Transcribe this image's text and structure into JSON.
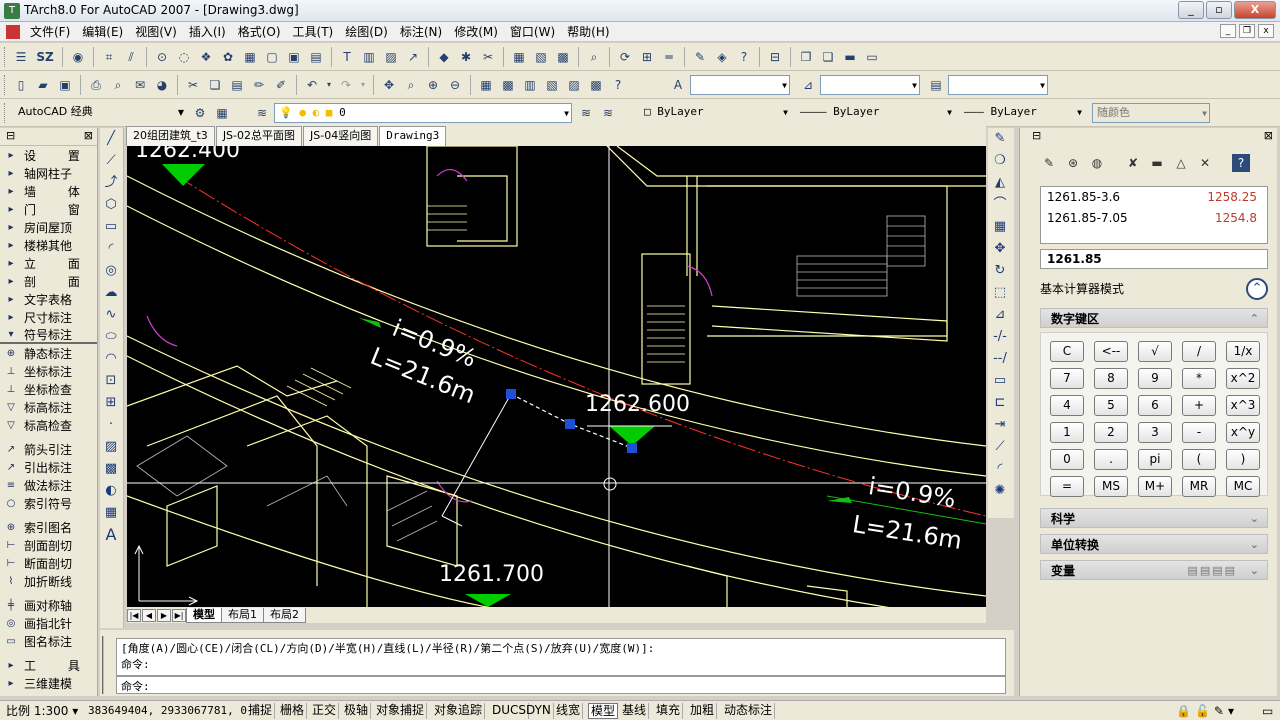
{
  "window": {
    "title": "TArch8.0 For AutoCAD 2007 - [Drawing3.dwg]",
    "min": "_",
    "max": "▫",
    "close": "X"
  },
  "menu": [
    "文件(F)",
    "编辑(E)",
    "视图(V)",
    "插入(I)",
    "格式(O)",
    "工具(T)",
    "绘图(D)",
    "标注(N)",
    "修改(M)",
    "窗口(W)",
    "帮助(H)"
  ],
  "toolbar1": {
    "sz_label": "SZ"
  },
  "toolbar3": {
    "workspace": "AutoCAD 经典",
    "layer": "0",
    "color": "ByLayer",
    "linetype": "ByLayer",
    "lineweight": "ByLayer",
    "plotstyle": "随颜色"
  },
  "left_panel": {
    "items": [
      {
        "icon": "▸",
        "label": "设  置",
        "sp": true
      },
      {
        "icon": "▸",
        "label": "轴网柱子"
      },
      {
        "icon": "▸",
        "label": "墙  体",
        "sp": true
      },
      {
        "icon": "▸",
        "label": "门  窗",
        "sp": true
      },
      {
        "icon": "▸",
        "label": "房间屋顶"
      },
      {
        "icon": "▸",
        "label": "楼梯其他"
      },
      {
        "icon": "▸",
        "label": "立  面",
        "sp": true
      },
      {
        "icon": "▸",
        "label": "剖  面",
        "sp": true
      },
      {
        "icon": "▸",
        "label": "文字表格"
      },
      {
        "icon": "▸",
        "label": "尺寸标注"
      },
      {
        "icon": "▾",
        "label": "符号标注",
        "sel": true
      },
      {
        "icon": "⊕",
        "label": "静态标注"
      },
      {
        "icon": "⊥",
        "label": "坐标标注"
      },
      {
        "icon": "⊥",
        "label": "坐标检查"
      },
      {
        "icon": "▽",
        "label": "标高标注"
      },
      {
        "icon": "▽",
        "label": "标高检查"
      },
      {
        "icon": "↗",
        "label": "箭头引注",
        "gap": true
      },
      {
        "icon": "↗",
        "label": "引出标注"
      },
      {
        "icon": "≡",
        "label": "做法标注"
      },
      {
        "icon": "○",
        "label": "索引符号"
      },
      {
        "icon": "⊕",
        "label": "索引图名",
        "gap": true
      },
      {
        "icon": "⊢",
        "label": "剖面剖切"
      },
      {
        "icon": "⊢",
        "label": "断面剖切"
      },
      {
        "icon": "⌇",
        "label": "加折断线"
      },
      {
        "icon": "╪",
        "label": "画对称轴",
        "gap": true
      },
      {
        "icon": "◎",
        "label": "画指北针"
      },
      {
        "icon": "▭",
        "label": "图名标注"
      },
      {
        "icon": "▸",
        "label": "工  具",
        "sp": true,
        "gap": true
      },
      {
        "icon": "▸",
        "label": "三维建模"
      }
    ]
  },
  "tabs": [
    "20组团建筑_t3",
    "JS-02总平面图",
    "JS-04竖向图",
    "Drawing3"
  ],
  "canvas": {
    "elev_top": "1262.400",
    "slope_a": "i=0.9%",
    "len_a": "L=21.6m",
    "elev_mid": "1262.600",
    "slope_b": "i=0.9%",
    "len_b": "L=21.6m",
    "elev_bottom": "1261.700"
  },
  "layout_tabs": [
    "模型",
    "布局1",
    "布局2"
  ],
  "command": {
    "history": "[角度(A)/圆心(CE)/闭合(CL)/方向(D)/半宽(H)/直线(L)/半径(R)/第二个点(S)/放弃(U)/宽度(W)]:",
    "prompt1": "命令:",
    "prompt2": "命令:"
  },
  "calc": {
    "history": [
      {
        "expr": "1261.85-3.6",
        "result": "1258.25"
      },
      {
        "expr": "1261.85-7.05",
        "result": "1254.8"
      }
    ],
    "display": "1261.85",
    "mode": "基本计算器模式",
    "numpad_title": "数字键区",
    "keys": [
      "C",
      "<--",
      "√",
      "/",
      "1/x",
      "7",
      "8",
      "9",
      "*",
      "x^2",
      "4",
      "5",
      "6",
      "+",
      "x^3",
      "1",
      "2",
      "3",
      "-",
      "x^y",
      "0",
      ".",
      "pi",
      "(",
      ")",
      "=",
      "MS",
      "M+",
      "MR",
      "MC"
    ],
    "sec_science": "科学",
    "sec_units": "单位转换",
    "sec_vars": "变量"
  },
  "status": {
    "scale": "比例 1:300",
    "coords": "383649404, 2933067781, 0",
    "toggles": [
      "捕捉",
      "栅格",
      "正交",
      "极轴",
      "对象捕捉",
      "对象追踪",
      "DUCS",
      "DYN",
      "线宽",
      "模型",
      "基线",
      "填充",
      "加粗",
      "动态标注"
    ]
  },
  "colors": {
    "canvas_bg": "#000000",
    "road_line": "#ffffaa",
    "center_line": "#ff3030",
    "grip": "#1e4fd8",
    "marker": "#00cc00",
    "calc_result": "#c0392b"
  }
}
